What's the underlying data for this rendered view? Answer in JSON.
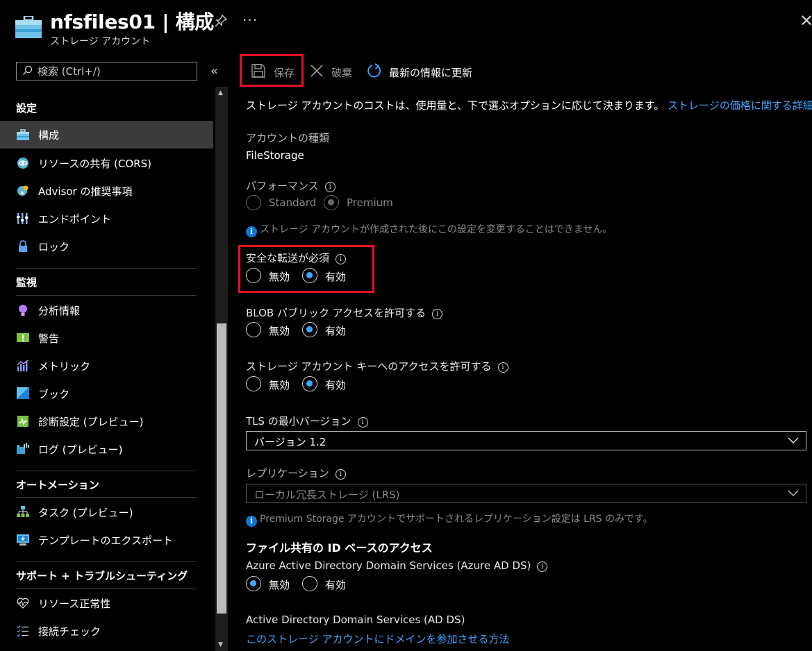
{
  "header": {
    "title": "nfsfiles01 | 構成",
    "subtitle": "ストレージ アカウント",
    "more_label": "···",
    "close_label": "✕"
  },
  "sidebar": {
    "search_placeholder": "検索 (Ctrl+/)",
    "collapse_label": "«",
    "sections": [
      {
        "title": "設定",
        "items": [
          {
            "label": "構成",
            "icon": "config-icon",
            "selected": true
          },
          {
            "label": "リソースの共有 (CORS)",
            "icon": "cors-icon"
          },
          {
            "label": "Advisor の推奨事項",
            "icon": "advisor-icon"
          },
          {
            "label": "エンドポイント",
            "icon": "endpoints-icon"
          },
          {
            "label": "ロック",
            "icon": "lock-icon"
          }
        ]
      },
      {
        "title": "監視",
        "items": [
          {
            "label": "分析情報",
            "icon": "insights-icon"
          },
          {
            "label": "警告",
            "icon": "alerts-icon"
          },
          {
            "label": "メトリック",
            "icon": "metrics-icon"
          },
          {
            "label": "ブック",
            "icon": "workbooks-icon"
          },
          {
            "label": "診断設定 (プレビュー)",
            "icon": "diagnostics-icon"
          },
          {
            "label": "ログ (プレビュー)",
            "icon": "logs-icon"
          }
        ]
      },
      {
        "title": "オートメーション",
        "items": [
          {
            "label": "タスク (プレビュー)",
            "icon": "tasks-icon"
          },
          {
            "label": "テンプレートのエクスポート",
            "icon": "export-template-icon"
          }
        ]
      },
      {
        "title": "サポート + トラブルシューティング",
        "items": [
          {
            "label": "リソース正常性",
            "icon": "resource-health-icon"
          },
          {
            "label": "接続チェック",
            "icon": "connectivity-check-icon"
          }
        ]
      }
    ]
  },
  "toolbar": {
    "save_label": "保存",
    "discard_label": "破棄",
    "refresh_label": "最新の情報に更新"
  },
  "content": {
    "cost_note": "ストレージ アカウントのコストは、使用量と、下で選ぶオプションに応じて決まります。",
    "pricing_link": "ストレージの価格に関する詳細情報",
    "account_kind_label": "アカウントの種類",
    "account_kind_value": "FileStorage",
    "performance_label": "パフォーマンス",
    "performance_options": [
      "Standard",
      "Premium"
    ],
    "performance_note": "ストレージ アカウントが作成された後にこの設定を変更することはできません。",
    "secure_transfer_label": "安全な転送が必須",
    "blob_public_label": "BLOB パブリック アクセスを許可する",
    "key_access_label": "ストレージ アカウント キーへのアクセスを許可する",
    "disabled_label": "無効",
    "enabled_label": "有効",
    "tls_label": "TLS の最小バージョン",
    "tls_value": "バージョン 1.2",
    "replication_label": "レプリケーション",
    "replication_value": "ローカル冗長ストレージ (LRS)",
    "replication_note": "Premium Storage アカウントでサポートされるレプリケーション設定は LRS のみです。",
    "identity_heading": "ファイル共有の ID ベースのアクセス",
    "aadds_label": "Azure Active Directory Domain Services (Azure AD DS)",
    "adds_label": "Active Directory Domain Services (AD DS)",
    "adds_link": "このストレージ アカウントにドメインを参加させる方法"
  }
}
